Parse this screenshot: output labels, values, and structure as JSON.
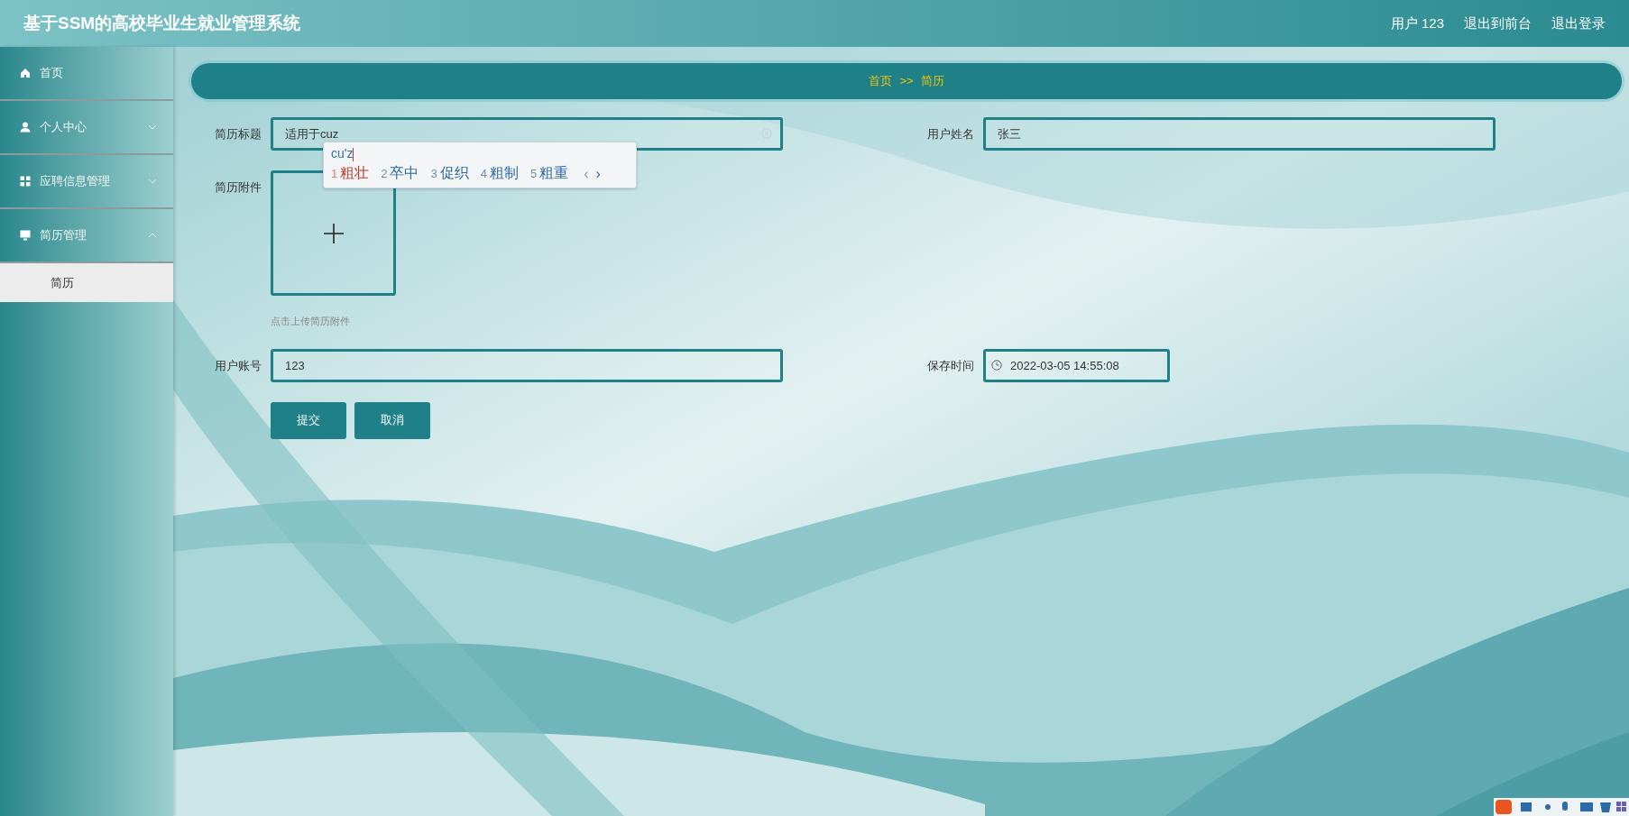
{
  "header": {
    "title": "基于SSM的高校毕业生就业管理系统",
    "links": [
      "用户 123",
      "退出到前台",
      "退出登录"
    ]
  },
  "sidebar": {
    "items": [
      {
        "label": "首页"
      },
      {
        "label": "个人中心",
        "expanded": false
      },
      {
        "label": "应聘信息管理",
        "expanded": false
      },
      {
        "label": "简历管理",
        "expanded": true,
        "children": [
          {
            "label": "简历",
            "selected": true
          }
        ]
      }
    ]
  },
  "breadcrumb": {
    "items": [
      "首页",
      "简历"
    ],
    "separator": ">>"
  },
  "form": {
    "fields": [
      {
        "label": "简历标题",
        "kind": "clearable",
        "value": "适用于cuz"
      },
      {
        "label": "用户姓名",
        "kind": "text",
        "value": "张三"
      },
      {
        "label": "简历附件",
        "kind": "upload",
        "hint": "点击上传简历附件"
      },
      {
        "label": "用户账号",
        "kind": "text",
        "value": "123"
      },
      {
        "label": "保存时间",
        "kind": "datetime",
        "value": "2022-03-05 14:55:08"
      }
    ],
    "buttons": [
      "提交",
      "取消"
    ]
  },
  "ime": {
    "composition": "cu'z",
    "candidates": [
      {
        "number": "1",
        "text": "粗壮",
        "selected": true
      },
      {
        "number": "2",
        "text": "卒中",
        "selected": false
      },
      {
        "number": "3",
        "text": "促织",
        "selected": false
      },
      {
        "number": "4",
        "text": "粗制",
        "selected": false
      },
      {
        "number": "5",
        "text": "粗重",
        "selected": false
      }
    ],
    "pager": [
      {
        "glyph": "‹",
        "disabled": true
      },
      {
        "glyph": "›",
        "disabled": false
      }
    ]
  }
}
